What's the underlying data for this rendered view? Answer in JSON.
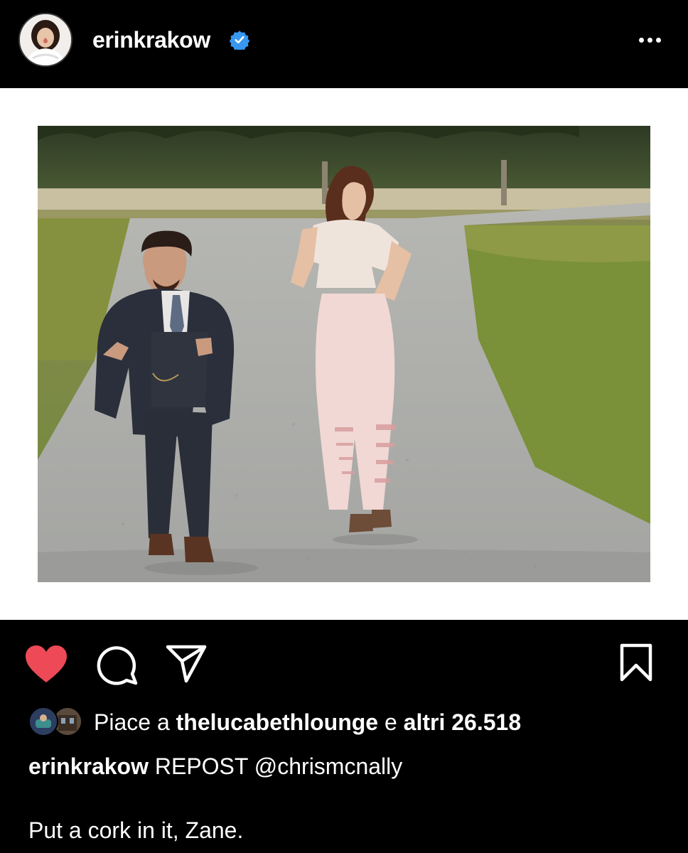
{
  "post": {
    "username": "erinkrakow",
    "verified": true,
    "more_icon": "more-horizontal-icon"
  },
  "photo": {
    "icon": "photo-image"
  },
  "actions": {
    "like_icon": "heart-filled-icon",
    "comment_icon": "comment-icon",
    "share_icon": "send-icon",
    "save_icon": "bookmark-icon",
    "like_color": "#ed4956"
  },
  "likes": {
    "prefix": "Piace a",
    "first_liker": "thelucabethlounge",
    "connector": "e",
    "others": "altri 26.518"
  },
  "caption": {
    "username": "erinkrakow",
    "text": "REPOST @chrismcnally",
    "body": "Put a cork in it, Zane."
  },
  "colors": {
    "background": "#000000",
    "verified_blue": "#3897f0"
  }
}
